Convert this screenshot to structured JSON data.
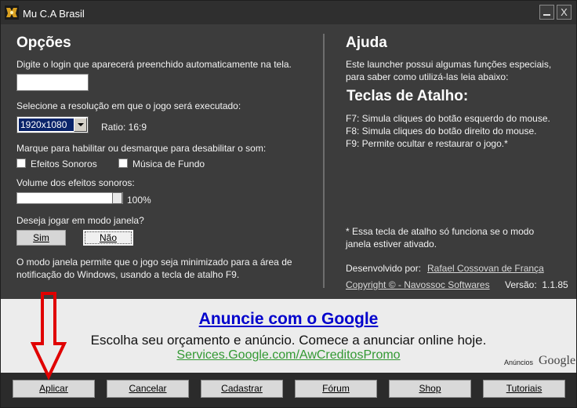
{
  "window": {
    "title": "Mu C.A Brasil",
    "minimize_label": "_",
    "close_label": "X"
  },
  "options": {
    "heading": "Opções",
    "login_prompt": "Digite o login que aparecerá preenchido automaticamente na tela.",
    "login_value": "",
    "resolution_prompt": "Selecione a resolução em que o jogo será executado:",
    "resolution_selected": "1920x1080",
    "ratio": "Ratio: 16:9",
    "sound_prompt": "Marque para habilitar ou desmarque para desabilitar o som:",
    "sound_effects_label": "Efeitos Sonoros",
    "background_music_label": "Música de Fundo",
    "volume_label": "Volume dos efeitos sonoros:",
    "volume_value": "100%",
    "volume_fraction": 1.0,
    "window_mode_prompt": "Deseja jogar em modo janela?",
    "yes_label": "Sim",
    "no_label": "Não",
    "window_mode_note_1": "O modo janela permite que o jogo seja minimizado para a área de",
    "window_mode_note_2": "notificação do Windows, usando a tecla de atalho F9."
  },
  "help": {
    "heading": "Ajuda",
    "intro_1": "Este launcher possui algumas funções especiais,",
    "intro_2": "para saber como utilizá-las leia abaixo:",
    "shortcuts_heading": "Teclas de Atalho:",
    "shortcut_f7": "F7: Simula cliques do botão esquerdo do mouse.",
    "shortcut_f8": "F8: Simula cliques do botão direito do mouse.",
    "shortcut_f9": "F9: Permite ocultar e restaurar o jogo.*",
    "footnote_1": "* Essa tecla de atalho só funciona se o modo",
    "footnote_2": "janela estiver ativado.",
    "developed_by_label": "Desenvolvido por:",
    "developer_name": "Rafael Cossovan de França",
    "copyright": "Copyright © - Navossoc Softwares",
    "version": "Versão:  1.1.85"
  },
  "ad": {
    "title": "Anuncie com o Google",
    "text": "Escolha seu orçamento e anúncio. Comece a anunciar online hoje.",
    "url": "Services.Google.com/AwCreditosPromo",
    "badge_label": "Anúncios",
    "badge_brand": "Google"
  },
  "buttons": {
    "aplicar": "Aplicar",
    "cancelar": "Cancelar",
    "cadastrar": "Cadastrar",
    "forum": "Fórum",
    "shop": "Shop",
    "tutoriais": "Tutoriais"
  },
  "colors": {
    "background": "#3c3c3c",
    "annotation_arrow": "#e00000",
    "ad_title": "#0000cc",
    "ad_url": "#339933"
  },
  "icons": {
    "app_icon": "game-logo-icon",
    "annotation": "down-arrow-icon"
  }
}
